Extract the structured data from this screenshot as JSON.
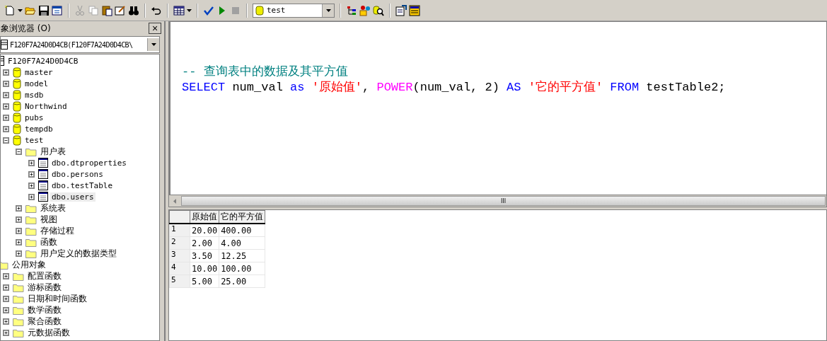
{
  "toolbar": {
    "database_combo": {
      "value": "test"
    }
  },
  "object_browser": {
    "title": "象浏览器 (O)",
    "close": "×",
    "server_combo": {
      "value": "F120F7A24D0D4CB(F120F7A24D0D4CB\\"
    },
    "tree": [
      {
        "label": "F120F7A24D0D4CB",
        "kind": "server",
        "children": [
          {
            "label": "master",
            "kind": "database",
            "expanded": false,
            "selected": false
          },
          {
            "label": "model",
            "kind": "database",
            "expanded": false,
            "selected": false
          },
          {
            "label": "msdb",
            "kind": "database",
            "expanded": false,
            "selected": false
          },
          {
            "label": "Northwind",
            "kind": "database",
            "expanded": false,
            "selected": false
          },
          {
            "label": "pubs",
            "kind": "database",
            "expanded": false,
            "selected": false
          },
          {
            "label": "tempdb",
            "kind": "database",
            "expanded": false,
            "selected": false
          },
          {
            "label": "test",
            "kind": "database",
            "expanded": true,
            "selected": false,
            "children": [
              {
                "label": "用户表",
                "kind": "folder",
                "expanded": true,
                "selected": false,
                "children": [
                  {
                    "label": "dbo.dtproperties",
                    "kind": "table",
                    "expanded": false,
                    "selected": false
                  },
                  {
                    "label": "dbo.persons",
                    "kind": "table",
                    "expanded": false,
                    "selected": false
                  },
                  {
                    "label": "dbo.testTable",
                    "kind": "table",
                    "expanded": false,
                    "selected": false
                  },
                  {
                    "label": "dbo.users",
                    "kind": "table",
                    "expanded": false,
                    "selected": true
                  }
                ]
              },
              {
                "label": "系统表",
                "kind": "folder",
                "expanded": false,
                "selected": false
              },
              {
                "label": "视图",
                "kind": "folder",
                "expanded": false,
                "selected": false
              },
              {
                "label": "存储过程",
                "kind": "folder",
                "expanded": false,
                "selected": false
              },
              {
                "label": "函数",
                "kind": "folder",
                "expanded": false,
                "selected": false
              },
              {
                "label": "用户定义的数据类型",
                "kind": "folder",
                "expanded": false,
                "selected": false
              }
            ]
          }
        ]
      },
      {
        "label": "公用对象",
        "kind": "folder",
        "children": [
          {
            "label": "配置函数",
            "kind": "folder",
            "expanded": false,
            "selected": false
          },
          {
            "label": "游标函数",
            "kind": "folder",
            "expanded": false,
            "selected": false
          },
          {
            "label": "日期和时间函数",
            "kind": "folder",
            "expanded": false,
            "selected": false
          },
          {
            "label": "数学函数",
            "kind": "folder",
            "expanded": false,
            "selected": false
          },
          {
            "label": "聚合函数",
            "kind": "folder",
            "expanded": false,
            "selected": false
          },
          {
            "label": "元数据函数",
            "kind": "folder",
            "expanded": false,
            "selected": false
          }
        ]
      }
    ]
  },
  "editor": {
    "lines": [
      [
        {
          "text": "-- 查询表中的数据及其平方值",
          "kind": "comment"
        }
      ],
      [
        {
          "text": "SELECT",
          "kind": "keyword"
        },
        {
          "text": " num_val ",
          "kind": "plain"
        },
        {
          "text": "as",
          "kind": "keyword"
        },
        {
          "text": " '原始值'",
          "kind": "string"
        },
        {
          "text": ", ",
          "kind": "plain"
        },
        {
          "text": "POWER",
          "kind": "function"
        },
        {
          "text": "(num_val, 2) ",
          "kind": "plain"
        },
        {
          "text": "AS",
          "kind": "keyword"
        },
        {
          "text": " '它的平方值'",
          "kind": "string"
        },
        {
          "text": " FROM",
          "kind": "keyword"
        },
        {
          "text": " testTable2;",
          "kind": "plain"
        }
      ]
    ],
    "scrollbar_grip": "III"
  },
  "results": {
    "columns": [
      "原始值",
      "它的平方值"
    ],
    "rows": [
      {
        "number": "1",
        "cells": [
          "20.00",
          "400.00"
        ]
      },
      {
        "number": "2",
        "cells": [
          "2.00",
          "4.00"
        ]
      },
      {
        "number": "3",
        "cells": [
          "3.50",
          "12.25"
        ]
      },
      {
        "number": "4",
        "cells": [
          "10.00",
          "100.00"
        ]
      },
      {
        "number": "5",
        "cells": [
          "5.00",
          "25.00"
        ]
      }
    ]
  }
}
